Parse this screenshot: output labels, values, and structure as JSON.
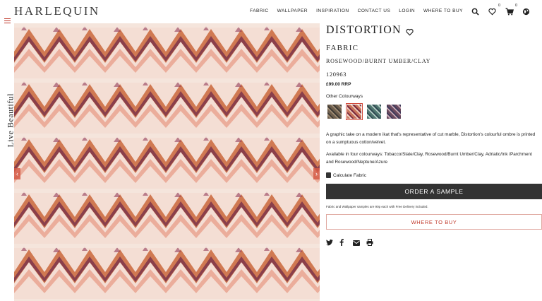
{
  "header": {
    "logo": "HARLEQUIN",
    "nav": [
      "FABRIC",
      "WALLPAPER",
      "INSPIRATION",
      "CONTACT US",
      "LOGIN",
      "WHERE TO BUY"
    ],
    "wishlist_count": "0",
    "cart_count": "0",
    "icons": [
      "search-icon",
      "heart-icon",
      "cart-icon",
      "globe-icon"
    ]
  },
  "sidebar": {
    "tagline": "Live Beautiful",
    "menu_icon": "hamburger-icon"
  },
  "gallery": {
    "prev": "‹",
    "next": "›"
  },
  "product": {
    "name": "DISTORTION",
    "type": "FABRIC",
    "colourway": "ROSEWOOD/BURNT UMBER/CLAY",
    "code": "120963",
    "price": "£99.00 RRP",
    "other_colourways_label": "Other Colourways",
    "swatches": [
      {
        "name": "Tobacco/Slate/Clay",
        "color": "#6e5e4c"
      },
      {
        "name": "Rosewood/Burnt Umber/Clay",
        "color": "#c8735a"
      },
      {
        "name": "Adriatic/Ink/Parchment",
        "color": "#4f7670"
      },
      {
        "name": "Rosewood/Neptune/Azure",
        "color": "#6a4a5e"
      }
    ],
    "description": "A graphic take on a modern ikat that's representative of cut marble, Distortion's colourful ombre is printed on a sumptuous cotton/velvet.",
    "availability": "Available in four colourways: Tobacco/Slate/Clay, Rosewood/Burnt Umber/Clay, Adriatic/Ink /Parchment and Rosewood/Neptune/Azure",
    "calculate_label": "Calculate Fabric",
    "order_sample_label": "ORDER A SAMPLE",
    "sample_note": "Fabric and Wallpaper samples are 90p each with Free Delivery included.",
    "where_to_buy_label": "WHERE TO BUY",
    "share_icons": [
      "twitter-icon",
      "facebook-icon",
      "email-icon",
      "print-icon"
    ]
  },
  "colors": {
    "accent": "#c0392b",
    "dark_button": "#333333"
  }
}
